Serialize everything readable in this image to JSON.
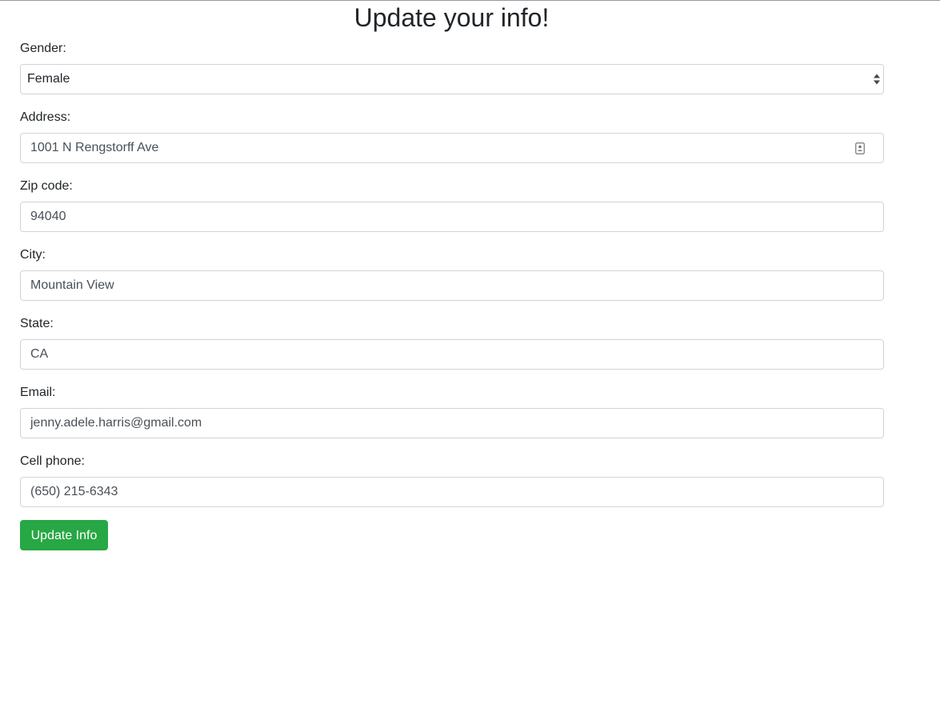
{
  "page": {
    "title": "Update your info!"
  },
  "form": {
    "gender": {
      "label": "Gender:",
      "value": "Female"
    },
    "address": {
      "label": "Address:",
      "value": "1001 N Rengstorff Ave"
    },
    "zip": {
      "label": "Zip code:",
      "value": "94040"
    },
    "city": {
      "label": "City:",
      "value": "Mountain View"
    },
    "state": {
      "label": "State:",
      "value": "CA"
    },
    "email": {
      "label": "Email:",
      "value": "jenny.adele.harris@gmail.com"
    },
    "phone": {
      "label": "Cell phone:",
      "value": "(650) 215-6343"
    },
    "submit_label": "Update Info"
  },
  "icons": {
    "select_arrows": "chevron-up-down-icon",
    "address_autofill": "contact-card-icon"
  },
  "colors": {
    "submit_button": "#28a745",
    "field_border": "#ced4da",
    "text": "#212529"
  }
}
